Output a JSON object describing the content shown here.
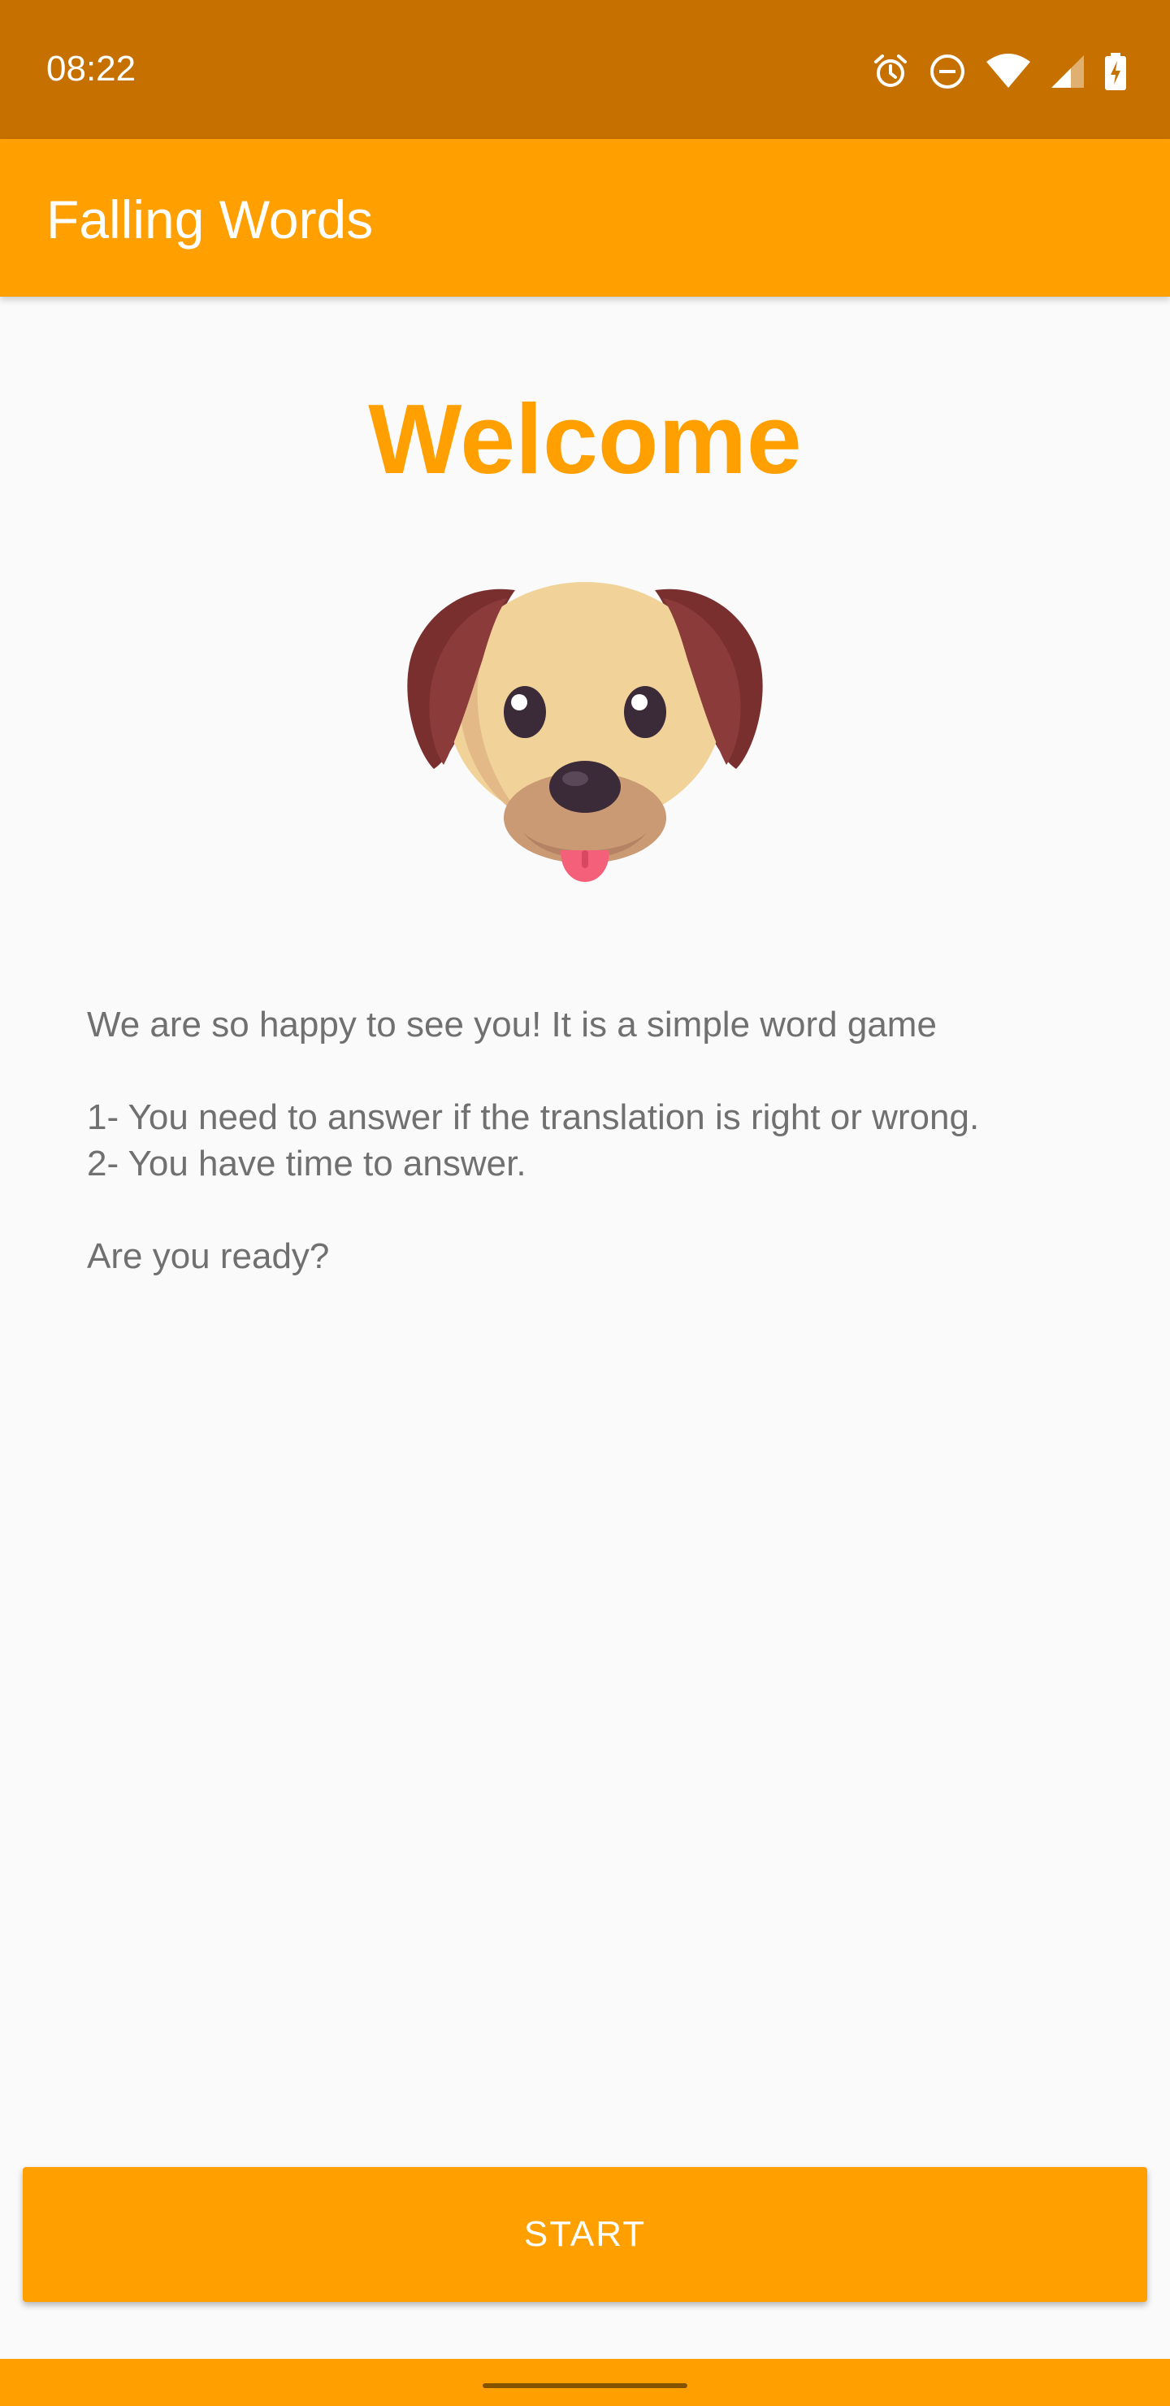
{
  "status_bar": {
    "time": "08:22",
    "icons": [
      "alarm-icon",
      "do-not-disturb-icon",
      "wifi-icon",
      "signal-icon",
      "battery-charging-icon"
    ],
    "color": "#c67000"
  },
  "app_bar": {
    "title": "Falling Words",
    "color": "#ffa000"
  },
  "main": {
    "welcome_title": "Welcome",
    "image": "dog-face-icon",
    "intro_line": "We are so happy to see you! It is a simple word game",
    "rule_1": "1- You need to answer if the translation is right or wrong.",
    "rule_2": "2- You have time to answer.",
    "question": "Are you ready?"
  },
  "actions": {
    "start_label": "START"
  },
  "nav_bar": {
    "handle": "gesture-handle"
  },
  "colors": {
    "accent": "#ffa000",
    "status_bar": "#c67000",
    "background": "#fafafa",
    "body_text": "#707070"
  }
}
